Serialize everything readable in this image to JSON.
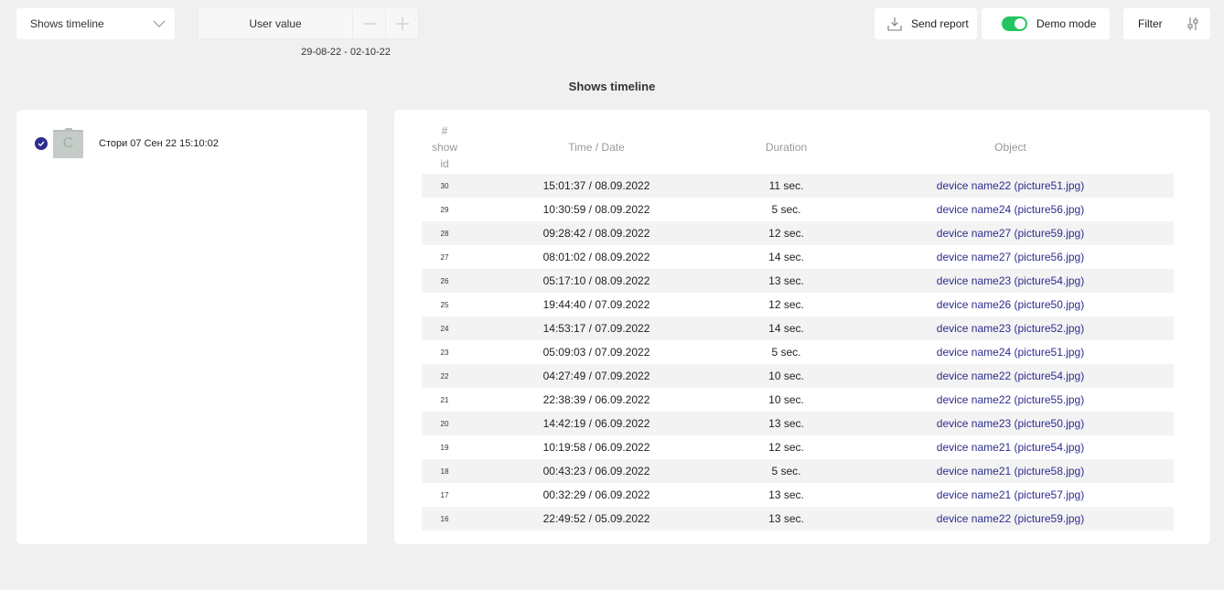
{
  "toolbar": {
    "select_value": "Shows timeline",
    "user_value_label": "User value",
    "date_range": "29-08-22 - 02-10-22",
    "send_report_label": "Send report",
    "demo_mode_label": "Demo mode",
    "filter_label": "Filter"
  },
  "page": {
    "title": "Shows timeline"
  },
  "sidebar": {
    "story_label": "Стори 07 Сен 22 15:10:02",
    "folder_letter": "C"
  },
  "table": {
    "headers": {
      "id_line1": "#",
      "id_line2": "show",
      "id_line3": "id",
      "time": "Time / Date",
      "duration": "Duration",
      "object": "Object"
    },
    "rows": [
      {
        "id": "30",
        "time": "15:01:37 / 08.09.2022",
        "duration": "11 sec.",
        "object": "device name22 (picture51.jpg)"
      },
      {
        "id": "29",
        "time": "10:30:59 / 08.09.2022",
        "duration": "5 sec.",
        "object": "device name24 (picture56.jpg)"
      },
      {
        "id": "28",
        "time": "09:28:42 / 08.09.2022",
        "duration": "12 sec.",
        "object": "device name27 (picture59.jpg)"
      },
      {
        "id": "27",
        "time": "08:01:02 / 08.09.2022",
        "duration": "14 sec.",
        "object": "device name27 (picture56.jpg)"
      },
      {
        "id": "26",
        "time": "05:17:10 / 08.09.2022",
        "duration": "13 sec.",
        "object": "device name23 (picture54.jpg)"
      },
      {
        "id": "25",
        "time": "19:44:40 / 07.09.2022",
        "duration": "12 sec.",
        "object": "device name26 (picture50.jpg)"
      },
      {
        "id": "24",
        "time": "14:53:17 / 07.09.2022",
        "duration": "14 sec.",
        "object": "device name23 (picture52.jpg)"
      },
      {
        "id": "23",
        "time": "05:09:03 / 07.09.2022",
        "duration": "5 sec.",
        "object": "device name24 (picture51.jpg)"
      },
      {
        "id": "22",
        "time": "04:27:49 / 07.09.2022",
        "duration": "10 sec.",
        "object": "device name22 (picture54.jpg)"
      },
      {
        "id": "21",
        "time": "22:38:39 / 06.09.2022",
        "duration": "10 sec.",
        "object": "device name22 (picture55.jpg)"
      },
      {
        "id": "20",
        "time": "14:42:19 / 06.09.2022",
        "duration": "13 sec.",
        "object": "device name23 (picture50.jpg)"
      },
      {
        "id": "19",
        "time": "10:19:58 / 06.09.2022",
        "duration": "12 sec.",
        "object": "device name21 (picture54.jpg)"
      },
      {
        "id": "18",
        "time": "00:43:23 / 06.09.2022",
        "duration": "5 sec.",
        "object": "device name21 (picture58.jpg)"
      },
      {
        "id": "17",
        "time": "00:32:29 / 06.09.2022",
        "duration": "13 sec.",
        "object": "device name21 (picture57.jpg)"
      },
      {
        "id": "16",
        "time": "22:49:52 / 05.09.2022",
        "duration": "13 sec.",
        "object": "device name22 (picture59.jpg)"
      }
    ]
  },
  "colors": {
    "accent": "#2e2c8f",
    "toggle_on": "#22c55e",
    "background": "#f0f0f0"
  },
  "icons": [
    "chevron-down-icon",
    "minus-icon",
    "plus-icon",
    "download-icon",
    "sliders-icon",
    "check-icon",
    "folder-icon"
  ]
}
